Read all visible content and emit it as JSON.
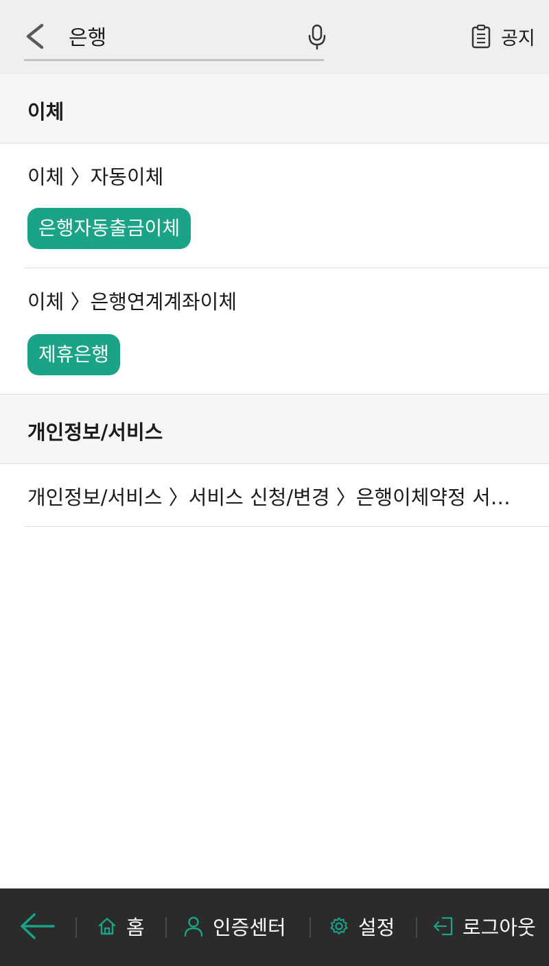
{
  "header": {
    "search_value": "은행",
    "notice_label": "공지"
  },
  "sections": [
    {
      "title": "이체",
      "items": [
        {
          "path": "이체 〉자동이체",
          "tag": "은행자동출금이체"
        },
        {
          "path": "이체 〉은행연계계좌이체",
          "tag": "제휴은행"
        }
      ]
    },
    {
      "title": "개인정보/서비스",
      "items": [
        {
          "path": "개인정보/서비스 〉서비스 신청/변경 〉은행이체약정 서…"
        }
      ]
    }
  ],
  "bottom_nav": {
    "home_label": "홈",
    "auth_label": "인증센터",
    "settings_label": "설정",
    "logout_label": "로그아웃"
  },
  "colors": {
    "accent": "#1aa386",
    "nav_background": "#2b2b2b",
    "header_background": "#efefef"
  }
}
